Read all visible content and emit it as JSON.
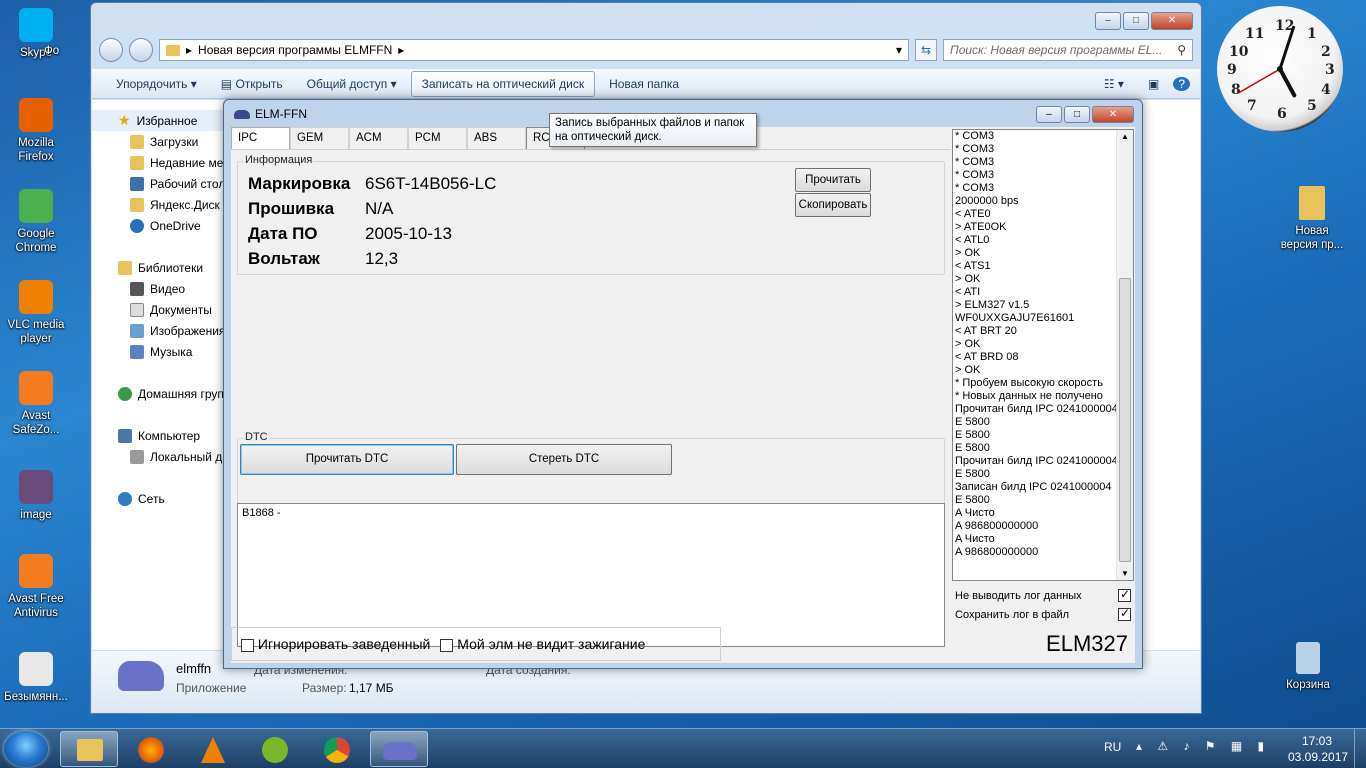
{
  "desktop": {
    "icons": [
      {
        "label": "Skype",
        "color": "#00aff0"
      },
      {
        "label": "Mozilla Firefox",
        "color": "#e66000"
      },
      {
        "label": "Google Chrome",
        "color": "#4caf50"
      },
      {
        "label": "VLC media player",
        "color": "#f08000"
      },
      {
        "label": "Avast SafeZo...",
        "color": "#f37c20"
      },
      {
        "label": "image",
        "color": "#6a4a7a"
      },
      {
        "label": "Avast Free Antivirus",
        "color": "#f37c20"
      },
      {
        "label": "Безымянн...",
        "color": "#e8e8e8"
      }
    ],
    "right_icons": [
      {
        "label": "Новая версия пр...",
        "color": "#e8c25a"
      },
      {
        "label": "Корзина",
        "color": "#b8d2e8"
      }
    ],
    "partial_label": "Фо"
  },
  "explorer": {
    "path_folder_label": "Новая версия программы ELMFFN",
    "search_placeholder": "Поиск: Новая версия программы EL...",
    "toolbar": {
      "organize": "Упорядочить",
      "open": "Открыть",
      "share": "Общий доступ",
      "burn": "Записать на оптический диск",
      "new_folder": "Новая папка"
    },
    "nav": {
      "favorites": "Избранное",
      "downloads": "Загрузки",
      "recent": "Недавние места",
      "desktop": "Рабочий стол",
      "yadisk": "Яндекс.Диск",
      "onedrive": "OneDrive",
      "libraries": "Библиотеки",
      "video": "Видео",
      "documents": "Документы",
      "images": "Изображения",
      "music": "Музыка",
      "homegroup": "Домашняя группа",
      "computer": "Компьютер",
      "localdisk": "Локальный диск",
      "network": "Сеть"
    },
    "details": {
      "name": "elmffn",
      "type": "Приложение",
      "size_label": "Размер:",
      "size_value": "1,17 МБ",
      "modified_label": "Дата изменения:",
      "created_label": "Дата создания:"
    }
  },
  "tooltip": "Запись выбранных файлов и папок на оптический диск.",
  "elm": {
    "title": "ELM-FFN",
    "tabs": [
      "IPC",
      "GEM",
      "ACM",
      "PCM",
      "ABS",
      "RCM"
    ],
    "info": {
      "legend": "Информация",
      "rows": [
        {
          "key": "Маркировка",
          "value": "6S6T-14B056-LC"
        },
        {
          "key": "Прошивка",
          "value": "N/A"
        },
        {
          "key": "Дата ПО",
          "value": "2005-10-13"
        },
        {
          "key": "Вольтаж",
          "value": "12,3"
        }
      ],
      "read_button": "Прочитать",
      "copy_button": "Скопировать"
    },
    "dtc": {
      "legend": "DTC",
      "read_button": "Прочитать DTC",
      "clear_button": "Стереть DTC",
      "output": "B1868 -"
    },
    "checkboxes": {
      "ignore_engine": "Игнорировать заведенный",
      "no_ignition": "Мой элм не видит зажигание"
    },
    "brand": "ELM327",
    "log": [
      "* COM3",
      "* COM3",
      "* COM3",
      "* COM3",
      "* COM3",
      "2000000 bps",
      "< ATE0",
      "> ATE0OK",
      "< ATL0",
      "> OK",
      "< ATS1",
      "> OK",
      "< ATI",
      "> ELM327 v1.5",
      "WF0UXXGAJU7E61601",
      "< AT BRT 20",
      "> OK",
      "< AT BRD 08",
      "> OK",
      "* Пробуем высокую скорость",
      "* Новых данных не получено",
      "Прочитан билд IPC 0241000004",
      "E 5800",
      "E 5800",
      "E 5800",
      "Прочитан билд IPC 0241000004",
      "E 5800",
      "Записан билд IPC 0241000004",
      "E 5800",
      "A Чисто",
      "A 986800000000",
      "A Чисто",
      "A 986800000000"
    ],
    "options": {
      "no_log": "Не выводить лог данных",
      "save_log": "Сохранить лог в файл"
    }
  },
  "clock": {
    "hour": 5,
    "minute": 3,
    "second": 40
  },
  "taskbar": {
    "lang": "RU",
    "time": "17:03",
    "date": "03.09.2017"
  }
}
